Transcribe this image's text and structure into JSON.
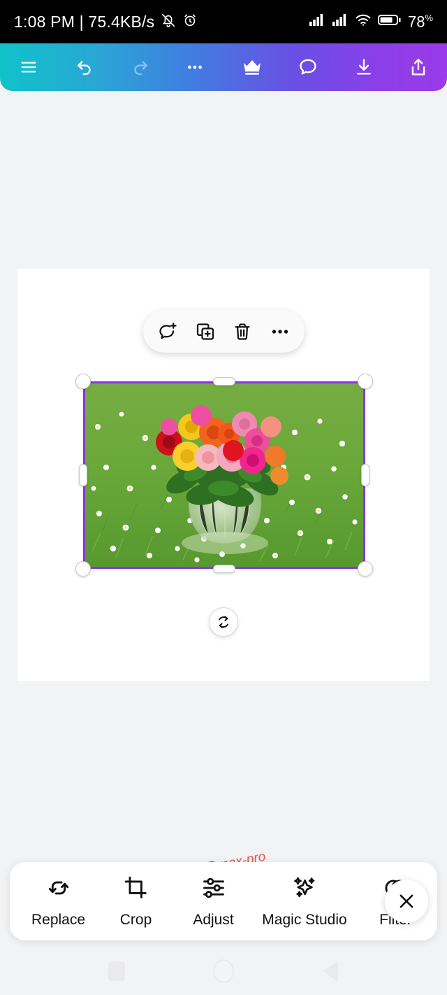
{
  "theme": {
    "toolbar_gradient_start": "#0fc3c8",
    "toolbar_gradient_end": "#9b3ae9",
    "selection_color": "#8b35e0",
    "watermark_color": "#e05a4b",
    "canvas_bg": "#f2f3f5",
    "artboard_bg": "#ffffff"
  },
  "status_bar": {
    "clock": "1:08 PM | 75.4KB/s",
    "icons": [
      "mute-icon",
      "alarm-icon",
      "signal-icon",
      "signal-2-icon",
      "wifi-icon",
      "battery-icon"
    ],
    "battery_percent": "78",
    "battery_percent_symbol": "%",
    "battery_level": 70
  },
  "top_toolbar": {
    "items": [
      {
        "name": "menu-icon",
        "label": "Menu",
        "enabled": true
      },
      {
        "name": "undo-icon",
        "label": "Undo",
        "enabled": true
      },
      {
        "name": "redo-icon",
        "label": "Redo",
        "enabled": false
      },
      {
        "name": "more-icon",
        "label": "More",
        "enabled": true
      },
      {
        "name": "crown-icon",
        "label": "Premium",
        "enabled": true
      },
      {
        "name": "comment-icon",
        "label": "Comments",
        "enabled": true
      },
      {
        "name": "download-icon",
        "label": "Download",
        "enabled": true
      },
      {
        "name": "share-icon",
        "label": "Share",
        "enabled": true
      }
    ]
  },
  "context_toolbar": {
    "items": [
      {
        "name": "add-comment-icon",
        "label": "Comment"
      },
      {
        "name": "duplicate-icon",
        "label": "Duplicate"
      },
      {
        "name": "delete-icon",
        "label": "Delete"
      },
      {
        "name": "more-options-icon",
        "label": "More"
      }
    ]
  },
  "canvas": {
    "watermark_text": "@max-pro",
    "selected_element": {
      "type": "image",
      "description": "Bouquet of multicolored roses in a glass vase on a daisy-covered lawn",
      "handles": [
        "top-left",
        "top-right",
        "bottom-left",
        "bottom-right",
        "top",
        "bottom",
        "left",
        "right"
      ],
      "rotate_handle_icon": "rotate-icon"
    }
  },
  "bottom_toolbar": {
    "items": [
      {
        "label": "Replace",
        "icon": "replace-icon"
      },
      {
        "label": "Crop",
        "icon": "crop-icon"
      },
      {
        "label": "Adjust",
        "icon": "adjust-icon"
      },
      {
        "label": "Magic Studio",
        "icon": "sparkles-icon"
      },
      {
        "label": "Filter",
        "icon": "filter-icon"
      }
    ],
    "close_label": "Close"
  },
  "nav_bar": {
    "items": [
      {
        "name": "recents-button",
        "label": "Recents"
      },
      {
        "name": "home-button",
        "label": "Home"
      },
      {
        "name": "back-button",
        "label": "Back"
      }
    ]
  }
}
